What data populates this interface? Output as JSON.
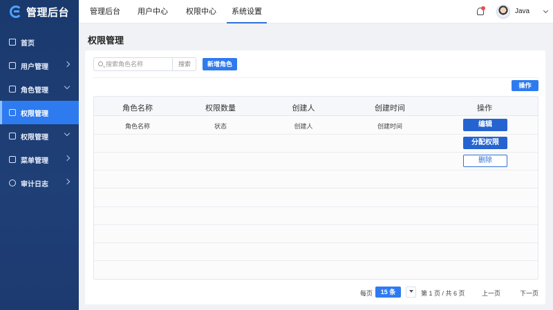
{
  "app": {
    "title": "管理后台"
  },
  "sidebar": {
    "items": [
      {
        "label": "首页",
        "icon": "home-icon",
        "expandable": false,
        "active": false
      },
      {
        "label": "用户管理",
        "icon": "document-icon",
        "expandable": true,
        "active": false
      },
      {
        "label": "角色管理",
        "icon": "document-icon",
        "expandable": true,
        "active": false
      },
      {
        "label": "权限管理",
        "icon": "document-icon",
        "expandable": false,
        "active": true
      },
      {
        "label": "权限管理",
        "icon": "monitor-icon",
        "expandable": true,
        "active": false
      },
      {
        "label": "菜单管理",
        "icon": "document-icon",
        "expandable": true,
        "active": false
      },
      {
        "label": "审计日志",
        "icon": "clock-icon",
        "expandable": true,
        "active": false
      }
    ]
  },
  "header": {
    "tabs": [
      {
        "label": "管理后台",
        "active": false
      },
      {
        "label": "用户中心",
        "active": false
      },
      {
        "label": "权限中心",
        "active": false
      },
      {
        "label": "系统设置",
        "active": true
      }
    ],
    "username": "Java"
  },
  "main": {
    "page_title": "权限管理",
    "search": {
      "placeholder": "搜索角色名称",
      "button_label": "搜索"
    },
    "add_role_label": "新增角色",
    "operation_label": "操作"
  },
  "table": {
    "columns": [
      "角色名称",
      "权限数量",
      "创建人",
      "创建时间",
      "操作"
    ],
    "rows": [
      {
        "cells": [
          "角色名称",
          "状态",
          "创建人",
          "创建时间"
        ]
      }
    ],
    "actions": [
      "编辑",
      "分配权限",
      "删除"
    ]
  },
  "pagination": {
    "per_page_label": "每页",
    "page_size": "15 条",
    "page_info": "第 1 页 / 共 6 页",
    "prev_label": "上一页",
    "next_label": "下一页"
  },
  "colors": {
    "accent": "#2e7bf0",
    "sidebar": "#1f3f77",
    "badge": "#f5474d"
  }
}
